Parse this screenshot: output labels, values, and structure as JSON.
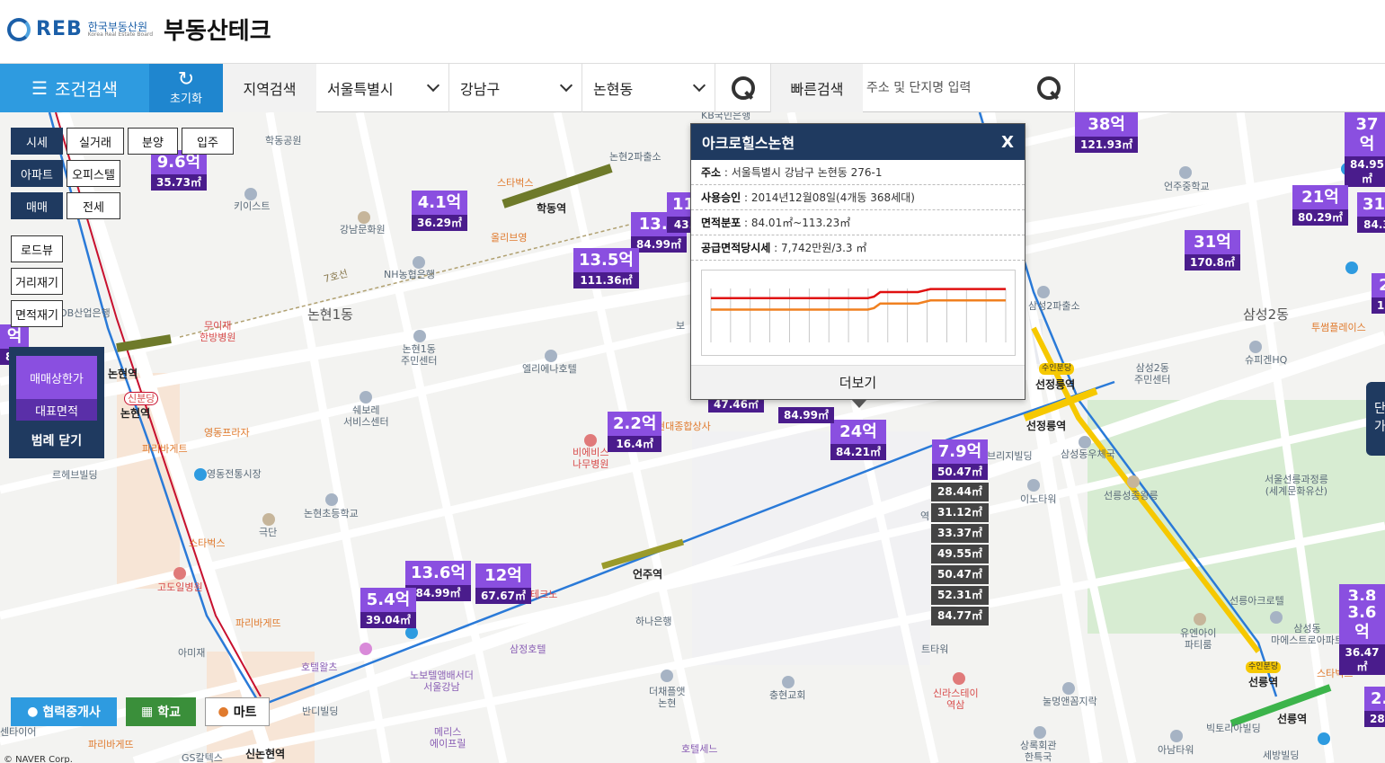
{
  "header": {
    "logo_reb": "REB",
    "logo_kr": "한국부동산원",
    "logo_en": "Korea Real Estate Board",
    "title": "부동산테크"
  },
  "toolbar": {
    "cond_search": "조건검색",
    "reset": "초기화",
    "region_label": "지역검색",
    "sido": "서울특별시",
    "gu": "강남구",
    "dong": "논현동",
    "quick_label": "빠른검색",
    "quick_placeholder": "주소 및 단지명 입력"
  },
  "filters": {
    "row1": [
      "시세",
      "실거래",
      "분양",
      "입주"
    ],
    "row2": [
      "아파트",
      "오피스텔"
    ],
    "row3": [
      "매매",
      "전세"
    ],
    "tools": [
      "로드뷰",
      "거리재기",
      "면적재기"
    ]
  },
  "legend": {
    "item1": "매매상한가",
    "item2": "대표면적",
    "close": "범례 닫기"
  },
  "popup": {
    "title": "아크로힐스논현",
    "close": "X",
    "address_label": "주소",
    "address": "서울특별시 강남구 논현동 276-1",
    "approval_label": "사용승인",
    "approval": "2014년12월08일(4개동 368세대)",
    "area_label": "면적분포",
    "area": "84.01㎡~113.23㎡",
    "price_label": "공급면적당시세",
    "price": "7,742만원/3.3 ㎡",
    "more": "더보기",
    "chart_series": [
      {
        "color": "#e01010",
        "values": [
          0.7,
          0.7,
          0.7,
          0.7,
          0.7,
          0.7,
          0.7,
          0.7,
          0.7,
          0.7,
          0.7,
          0.7,
          0.7,
          0.7,
          0.7,
          0.7,
          0.7,
          0.7,
          0.7,
          0.7,
          0.7,
          0.7,
          0.7,
          0.7,
          0.7,
          0.7,
          0.72,
          0.78,
          0.78,
          0.78,
          0.78,
          0.78,
          0.78,
          0.78,
          0.8,
          0.82,
          0.82,
          0.82,
          0.82,
          0.82,
          0.82,
          0.82,
          0.82,
          0.82,
          0.82,
          0.82,
          0.82,
          0.82
        ]
      },
      {
        "color": "#f08020",
        "values": [
          0.55,
          0.55,
          0.55,
          0.55,
          0.55,
          0.55,
          0.55,
          0.55,
          0.55,
          0.55,
          0.55,
          0.55,
          0.55,
          0.55,
          0.55,
          0.55,
          0.55,
          0.55,
          0.55,
          0.55,
          0.55,
          0.55,
          0.55,
          0.55,
          0.55,
          0.55,
          0.57,
          0.63,
          0.63,
          0.63,
          0.63,
          0.63,
          0.63,
          0.63,
          0.65,
          0.67,
          0.67,
          0.67,
          0.67,
          0.67,
          0.67,
          0.67,
          0.67,
          0.67,
          0.67,
          0.67,
          0.67,
          0.67
        ]
      }
    ]
  },
  "prices": [
    {
      "p": "9.6억",
      "a": "35.73㎡"
    },
    {
      "p": "4.1억",
      "a": "36.29㎡"
    },
    {
      "p": "13.8",
      "a": "84.99㎡"
    },
    {
      "p": "11",
      "a": "43."
    },
    {
      "p": "13.5억",
      "a": "111.36㎡"
    },
    {
      "p": "38억",
      "a": "121.93㎡"
    },
    {
      "p": "37억",
      "a": "84.95㎡"
    },
    {
      "p": "21억",
      "a": "80.29㎡"
    },
    {
      "p": "31.",
      "a": "84.3"
    },
    {
      "p": "31억",
      "a": "170.8㎡"
    },
    {
      "p": "2",
      "a": "15"
    },
    {
      "p": "2.2억",
      "a": "16.4㎡"
    },
    {
      "p": "24억",
      "a": "84.21㎡"
    },
    {
      "p": "7.9억",
      "a": "50.47㎡"
    },
    {
      "p": "13.6억",
      "a": "84.99㎡"
    },
    {
      "p": "12억",
      "a": "67.67㎡"
    },
    {
      "p": "5.4억",
      "a": "39.04㎡"
    },
    {
      "p": "3.8억",
      "a": ""
    },
    {
      "p": "3.6억",
      "a": "36.47㎡"
    },
    {
      "p": "2.",
      "a": "28."
    },
    {
      "p": "억",
      "a": "8㎡"
    }
  ],
  "partial_prices": [
    {
      "a": "47.46㎡"
    },
    {
      "a": "84.99㎡"
    }
  ],
  "sizes": [
    "28.44㎡",
    "31.12㎡",
    "33.37㎡",
    "49.55㎡",
    "50.47㎡",
    "52.31㎡",
    "84.77㎡"
  ],
  "map_labels": {
    "nonhyeon1": "논현1동",
    "samsung2": "삼성2동",
    "hakdong_park": "학동공원",
    "keyist": "키이스트",
    "gangnam_clinic": "강남문화원",
    "nh": "NH농협은행",
    "muijae": "무이재\n한방병원",
    "ob": "OB산업은행",
    "nh1_center": "논현1동\n주민센터",
    "ellienne": "엘리에나호텔",
    "swebo": "쉐보레\n서비스센터",
    "youngdong_plaza": "영동프라자",
    "youngdong_market": "영동전통시장",
    "rehaeb": "르헤브빌딩",
    "paris1": "파리바게트",
    "nonhyeon_school": "논현초등학교",
    "gukdan": "극단",
    "starbucks1": "스타벅스",
    "godeul": "고도일병원",
    "paris2": "파리바게뜨",
    "amiz": "아미재",
    "hotel_walz": "호텔왈츠",
    "novotel": "노보텔앰배서더\n서울강남",
    "samjeong": "삼정호텔",
    "hana": "하나은행",
    "mearis": "메리스\n에이프릴",
    "theche": "더채플앳\n논현",
    "choonghyun": "충현교회",
    "bandi": "반디빌딩",
    "gs": "GS칼텍스",
    "paris3": "파리바게뜨",
    "center1": "센타이어",
    "hakdong_station": "학동역",
    "nonhyeon_station": "논현역",
    "sinbundang": "신분당",
    "eonju_station": "언주역",
    "seonjeongneung_station": "선정릉역",
    "seonneung_station": "선릉역",
    "sinnonhyeon_station": "신논현역",
    "hakdong_police": "논현2파출소",
    "eonju_school": "언주중학교",
    "samsung2_center": "삼성2동\n주민센터",
    "sp2": "삼성2파출소",
    "supigen": "슈피겐HQ",
    "tuseom": "투썸플레이스",
    "seonneung_park": "서울선릉과정릉\n(세계문화유산)",
    "seonjeongneung_pal": "선릉성종왕릉",
    "ino": "이노타워",
    "samsungdong_post": "삼성동우체국",
    "seonneung_acrodel": "선릉아크로텔",
    "yuengai": "유엔아이\n파티룸",
    "samsung_maest": "삼성동\n마에스트로아파트",
    "nupmung": "눌멍앤꼼지락",
    "sinra": "신라스테이\n역삼",
    "sangrok": "상록회관\n한특국",
    "ana": "아남타워",
    "victoria": "빅토리아빌딩",
    "sebang": "세방빌딩",
    "starbucks2": "스타벅스",
    "hotel_seni": "호텔세느",
    "kb": "KB국민은행",
    "bimessage": "비에비스\n나무병원",
    "hyundai_center": "현대종합상사",
    "naver": "© NAVER Corp.",
    "line7": "7호선",
    "suin1": "수인분당",
    "suin2": "수인분당",
    "yeok": "역",
    "stower": "스타워",
    "teuktower": "트타워",
    "techo": "테크노",
    "ulli": "올리브영",
    "starbucks3": "스타벅스",
    "samsungdong": "삼성동",
    "bridge": "브리지빌딩",
    "bo": "보",
    "ro": "로",
    "ter": "터",
    "sinseo": "신서",
    "jung": "중"
  },
  "bottom": {
    "broker": "협력중개사",
    "school": "학교",
    "mart": "마트"
  },
  "right_tab": "단\n가",
  "colors": {
    "accent": "#2e9be0",
    "price_bg": "#8a4fe0",
    "area_bg": "#4a1c8c",
    "navy": "#1f3a60",
    "line_blue": "#2a7ad8",
    "line7": "#6e7a2a",
    "sinbundang": "#c8102e"
  }
}
